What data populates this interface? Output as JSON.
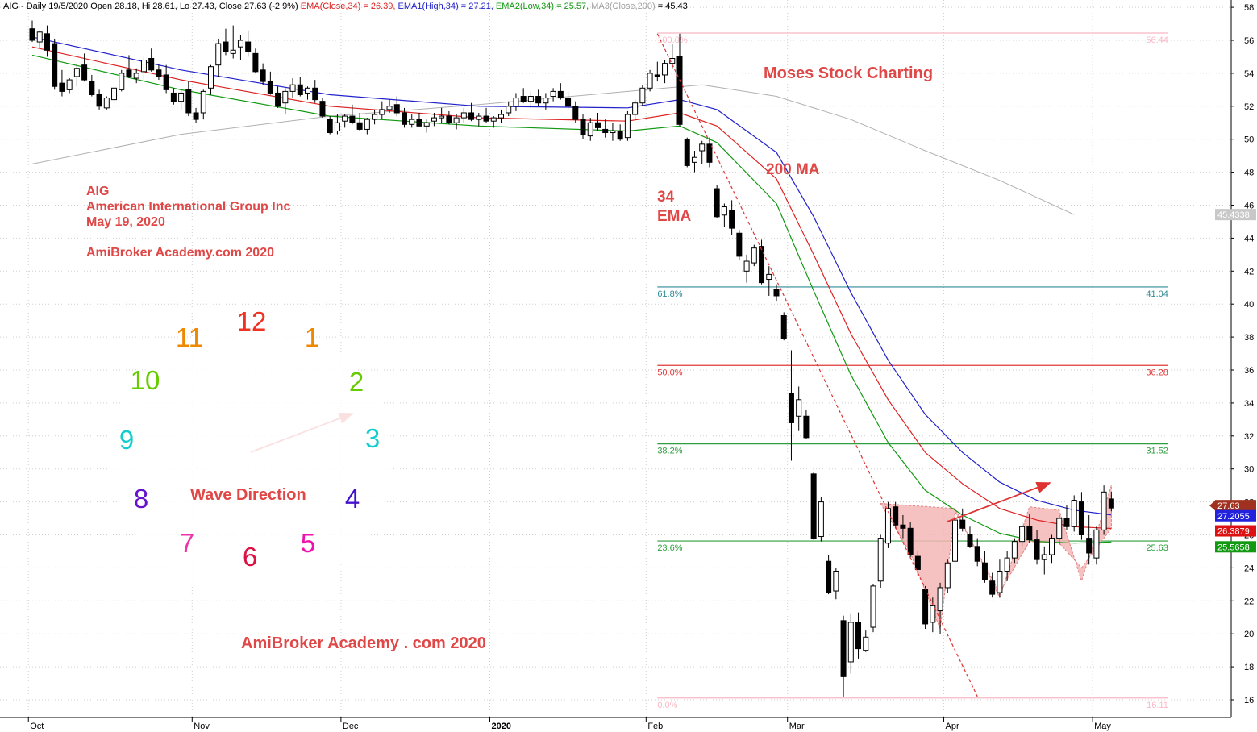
{
  "header": {
    "main": "AIG - Daily 19/5/2020 Open 28.18, Hi 28.61, Lo 27.43, Close 27.63 (-2.9%)",
    "ema": "EMA(Close,34) = 26.39,",
    "ema1": "EMA1(High,34) = 27.21,",
    "ema2": "EMA2(Low,34) = 25.57,",
    "ma3": "MA3(Close,200)",
    "ma3_val": "= 45.43"
  },
  "annotations": {
    "moses": "Moses Stock Charting",
    "ma200": "200 MA",
    "ema34_line1": "34",
    "ema34_line2": "EMA",
    "info": [
      "AIG",
      "American International Group Inc",
      "May 19, 2020",
      "AmiBroker Academy.com  2020"
    ],
    "wave": "Wave Direction",
    "footer": "AmiBroker  Academy . com  2020"
  },
  "clock": {
    "numbers": [
      "12",
      "1",
      "2",
      "3",
      "4",
      "5",
      "6",
      "7",
      "8",
      "9",
      "10",
      "11"
    ],
    "colors": [
      "#ee3322",
      "#ee8800",
      "#66cc00",
      "#11cccc",
      "#4411cc",
      "#ee11aa",
      "#dd1144",
      "#ee33aa",
      "#6611cc",
      "#11cccc",
      "#66cc00",
      "#ee8800"
    ]
  },
  "colors": {
    "ema": "#dd2222",
    "ema_high": "#2222cc",
    "ema_low": "#119911",
    "ma200": "#b0b0b0",
    "bull": "#ffffff",
    "bear": "#000000",
    "pattern_fill": "#f4b6b6",
    "pattern_stroke": "#e08080",
    "trend": "#dd3333",
    "fib_0": "#f9b8c4",
    "fib_23": "#2e9e3e",
    "fib_38": "#2e9e3e",
    "fib_50": "#e03838",
    "fib_61": "#2f8a96",
    "fib_100": "#f9b8c4"
  },
  "chart_data": {
    "type": "candlestick",
    "title": "AIG - Daily",
    "ylim": [
      15.5,
      58.5
    ],
    "y_ticks": [
      16,
      18,
      20,
      22,
      24,
      26,
      28,
      30,
      32,
      34,
      36,
      38,
      40,
      42,
      44,
      46,
      48,
      50,
      52,
      54,
      56,
      58
    ],
    "x_months": [
      {
        "label": "Oct",
        "bar": 1
      },
      {
        "label": "Nov",
        "bar": 23
      },
      {
        "label": "Dec",
        "bar": 43
      },
      {
        "label": "2020",
        "bar": 63
      },
      {
        "label": "Feb",
        "bar": 84
      },
      {
        "label": "Mar",
        "bar": 103
      },
      {
        "label": "Apr",
        "bar": 124
      },
      {
        "label": "May",
        "bar": 144
      }
    ],
    "grid": true,
    "candles": [
      [
        0,
        56.7,
        57.2,
        55.9,
        56.0
      ],
      [
        1,
        55.9,
        56.6,
        55.5,
        56.5
      ],
      [
        2,
        56.4,
        56.9,
        55.0,
        55.4
      ],
      [
        3,
        55.8,
        56.1,
        53.0,
        53.2
      ],
      [
        4,
        53.4,
        54.2,
        52.6,
        52.9
      ],
      [
        5,
        53.0,
        53.7,
        52.8,
        53.6
      ],
      [
        6,
        53.8,
        54.6,
        53.2,
        54.3
      ],
      [
        7,
        54.5,
        55.2,
        53.5,
        53.6
      ],
      [
        8,
        53.5,
        53.9,
        52.6,
        52.7
      ],
      [
        9,
        52.7,
        53.0,
        51.8,
        52.0
      ],
      [
        10,
        51.9,
        52.6,
        51.8,
        52.5
      ],
      [
        11,
        52.4,
        53.2,
        52.1,
        53.1
      ],
      [
        12,
        53.0,
        54.2,
        52.9,
        54.0
      ],
      [
        13,
        54.2,
        55.1,
        53.7,
        53.8
      ],
      [
        14,
        53.7,
        54.3,
        53.4,
        54.0
      ],
      [
        15,
        54.1,
        55.0,
        53.6,
        54.8
      ],
      [
        16,
        54.9,
        55.5,
        54.1,
        54.2
      ],
      [
        17,
        54.2,
        54.5,
        53.6,
        53.8
      ],
      [
        18,
        53.9,
        54.5,
        52.8,
        53.0
      ],
      [
        19,
        52.8,
        53.1,
        52.1,
        52.3
      ],
      [
        20,
        52.3,
        53.0,
        51.8,
        52.8
      ],
      [
        21,
        53.0,
        53.5,
        51.4,
        51.6
      ],
      [
        22,
        51.6,
        51.9,
        51.0,
        51.2
      ],
      [
        23,
        51.6,
        53.0,
        51.2,
        52.9
      ],
      [
        24,
        53.1,
        54.5,
        52.7,
        54.4
      ],
      [
        25,
        54.5,
        56.1,
        53.8,
        55.8
      ],
      [
        26,
        55.9,
        56.7,
        55.1,
        55.3
      ],
      [
        27,
        55.2,
        56.9,
        54.9,
        55.4
      ],
      [
        28,
        55.6,
        56.3,
        54.8,
        56.0
      ],
      [
        29,
        55.9,
        56.6,
        55.0,
        55.3
      ],
      [
        30,
        55.2,
        55.5,
        54.0,
        54.1
      ],
      [
        31,
        54.2,
        54.6,
        53.3,
        53.5
      ],
      [
        32,
        53.5,
        54.1,
        52.7,
        52.8
      ],
      [
        33,
        52.8,
        53.2,
        51.9,
        52.0
      ],
      [
        34,
        52.2,
        53.1,
        51.5,
        52.9
      ],
      [
        35,
        52.9,
        53.7,
        52.5,
        53.3
      ],
      [
        36,
        53.3,
        53.8,
        52.6,
        52.7
      ],
      [
        37,
        52.8,
        53.2,
        52.4,
        53.1
      ],
      [
        38,
        53.1,
        53.6,
        52.2,
        52.4
      ],
      [
        39,
        52.3,
        52.5,
        51.3,
        51.4
      ],
      [
        40,
        51.2,
        51.4,
        50.3,
        50.4
      ],
      [
        41,
        50.5,
        51.5,
        50.3,
        51.0
      ],
      [
        42,
        51.1,
        51.5,
        50.7,
        51.4
      ],
      [
        43,
        51.4,
        52.1,
        50.9,
        51.0
      ],
      [
        44,
        51.0,
        51.6,
        50.5,
        50.6
      ],
      [
        45,
        50.6,
        51.3,
        50.3,
        51.2
      ],
      [
        46,
        51.2,
        51.8,
        50.9,
        51.5
      ],
      [
        47,
        51.5,
        52.3,
        51.2,
        51.8
      ],
      [
        48,
        51.8,
        52.4,
        51.6,
        52.0
      ],
      [
        49,
        52.1,
        52.6,
        51.4,
        51.6
      ],
      [
        50,
        51.6,
        51.9,
        50.7,
        50.9
      ],
      [
        51,
        50.9,
        51.5,
        50.7,
        51.2
      ],
      [
        52,
        51.2,
        51.6,
        50.8,
        50.8
      ],
      [
        53,
        50.8,
        51.2,
        50.4,
        51.0
      ],
      [
        54,
        51.1,
        51.6,
        50.8,
        51.3
      ],
      [
        55,
        51.3,
        51.9,
        51.0,
        51.4
      ],
      [
        56,
        51.4,
        51.7,
        50.9,
        51.0
      ],
      [
        57,
        51.0,
        51.5,
        50.6,
        51.3
      ],
      [
        58,
        51.3,
        51.9,
        51.0,
        51.6
      ],
      [
        59,
        51.6,
        52.2,
        51.1,
        51.2
      ],
      [
        60,
        51.2,
        51.6,
        50.8,
        51.4
      ],
      [
        61,
        51.4,
        51.9,
        51.0,
        51.1
      ],
      [
        62,
        51.1,
        51.4,
        50.7,
        51.3
      ],
      [
        63,
        51.3,
        51.8,
        51.0,
        51.5
      ],
      [
        64,
        51.6,
        52.3,
        51.4,
        52.0
      ],
      [
        65,
        52.0,
        52.8,
        51.7,
        52.5
      ],
      [
        66,
        52.6,
        53.1,
        52.2,
        52.3
      ],
      [
        67,
        52.3,
        52.9,
        51.9,
        52.6
      ],
      [
        68,
        52.6,
        53.0,
        52.0,
        52.2
      ],
      [
        69,
        52.2,
        52.8,
        51.8,
        52.5
      ],
      [
        70,
        52.6,
        53.1,
        52.3,
        52.9
      ],
      [
        71,
        52.9,
        53.4,
        52.4,
        52.5
      ],
      [
        72,
        52.5,
        52.9,
        51.8,
        52.0
      ],
      [
        73,
        52.0,
        52.3,
        51.0,
        51.2
      ],
      [
        74,
        51.2,
        51.5,
        50.0,
        50.3
      ],
      [
        75,
        50.2,
        51.3,
        49.9,
        51.0
      ],
      [
        76,
        51.0,
        51.6,
        50.5,
        50.7
      ],
      [
        77,
        50.6,
        51.2,
        50.1,
        50.4
      ],
      [
        78,
        50.4,
        51.0,
        49.9,
        50.5
      ],
      [
        79,
        50.5,
        50.9,
        49.9,
        50.0
      ],
      [
        80,
        50.1,
        51.7,
        49.9,
        51.5
      ],
      [
        81,
        51.5,
        52.4,
        51.2,
        52.2
      ],
      [
        82,
        52.2,
        53.3,
        52.0,
        53.1
      ],
      [
        83,
        53.1,
        54.2,
        52.9,
        54.0
      ],
      [
        84,
        53.9,
        54.7,
        53.5,
        53.8
      ],
      [
        85,
        53.9,
        54.8,
        53.4,
        54.6
      ],
      [
        86,
        54.6,
        55.8,
        54.3,
        54.9
      ],
      [
        87,
        55.0,
        56.4,
        50.8,
        50.9
      ],
      [
        88,
        50.0,
        50.1,
        48.3,
        48.4
      ],
      [
        89,
        48.6,
        49.3,
        48.0,
        48.9
      ],
      [
        90,
        49.3,
        49.9,
        48.5,
        49.7
      ],
      [
        91,
        49.7,
        50.1,
        48.3,
        48.6
      ],
      [
        92,
        47.0,
        47.2,
        45.2,
        45.3
      ],
      [
        93,
        45.4,
        46.1,
        44.7,
        45.9
      ],
      [
        94,
        45.7,
        46.3,
        44.2,
        44.6
      ],
      [
        95,
        44.3,
        44.5,
        42.7,
        42.9
      ],
      [
        96,
        42.0,
        43.0,
        41.3,
        42.6
      ],
      [
        97,
        42.5,
        43.6,
        42.3,
        43.4
      ],
      [
        98,
        43.5,
        43.9,
        41.2,
        41.3
      ],
      [
        99,
        41.5,
        42.3,
        40.5,
        41.8
      ],
      [
        100,
        40.9,
        41.2,
        40.2,
        40.5
      ],
      [
        101,
        39.3,
        39.5,
        37.8,
        37.9
      ],
      [
        102,
        34.6,
        37.2,
        30.5,
        32.8
      ],
      [
        103,
        33.2,
        35.0,
        32.3,
        34.2
      ],
      [
        104,
        33.2,
        33.6,
        31.8,
        31.9
      ],
      [
        105,
        29.7,
        29.8,
        25.7,
        25.8
      ],
      [
        106,
        25.9,
        28.3,
        25.6,
        28.0
      ],
      [
        107,
        24.4,
        24.8,
        22.4,
        22.5
      ],
      [
        108,
        22.6,
        24.0,
        22.1,
        23.8
      ],
      [
        109,
        20.8,
        21.1,
        16.2,
        17.4
      ],
      [
        110,
        18.3,
        21.2,
        17.6,
        20.7
      ],
      [
        111,
        20.7,
        21.3,
        18.5,
        19.1
      ],
      [
        112,
        19.0,
        20.2,
        18.9,
        19.8
      ],
      [
        113,
        20.4,
        23.0,
        20.1,
        22.9
      ],
      [
        114,
        23.2,
        26.0,
        22.8,
        25.8
      ],
      [
        115,
        25.5,
        28.0,
        25.2,
        27.6
      ],
      [
        116,
        27.7,
        28.0,
        26.4,
        26.6
      ],
      [
        117,
        26.6,
        27.2,
        25.8,
        26.4
      ],
      [
        118,
        26.4,
        26.8,
        24.6,
        24.8
      ],
      [
        119,
        24.7,
        25.0,
        23.5,
        23.9
      ],
      [
        120,
        22.7,
        22.9,
        20.3,
        20.6
      ],
      [
        121,
        20.7,
        22.2,
        20.1,
        21.7
      ],
      [
        122,
        21.4,
        23.1,
        20.0,
        22.8
      ],
      [
        123,
        22.8,
        24.5,
        22.5,
        24.3
      ],
      [
        124,
        24.4,
        27.0,
        24.0,
        26.9
      ],
      [
        125,
        26.9,
        27.6,
        26.2,
        26.4
      ],
      [
        126,
        26.0,
        26.5,
        25.2,
        25.3
      ],
      [
        127,
        25.3,
        25.8,
        24.1,
        24.4
      ],
      [
        128,
        24.3,
        25.0,
        23.1,
        23.3
      ],
      [
        129,
        23.2,
        23.7,
        22.2,
        22.4
      ],
      [
        130,
        22.5,
        24.5,
        22.2,
        23.8
      ],
      [
        131,
        23.8,
        25.0,
        23.2,
        24.6
      ],
      [
        132,
        24.6,
        25.8,
        24.3,
        25.6
      ],
      [
        133,
        25.6,
        26.8,
        25.3,
        26.5
      ],
      [
        134,
        26.5,
        27.3,
        25.5,
        25.7
      ],
      [
        135,
        25.7,
        26.3,
        24.2,
        24.5
      ],
      [
        136,
        24.5,
        25.3,
        23.6,
        24.8
      ],
      [
        137,
        24.8,
        26.0,
        24.3,
        25.8
      ],
      [
        138,
        25.8,
        27.2,
        25.4,
        27.0
      ],
      [
        139,
        27.0,
        27.8,
        26.3,
        26.5
      ],
      [
        140,
        26.5,
        28.4,
        26.2,
        28.1
      ],
      [
        141,
        28.0,
        28.6,
        25.7,
        26.0
      ],
      [
        142,
        25.8,
        27.2,
        24.2,
        24.9
      ],
      [
        143,
        24.6,
        26.5,
        24.2,
        26.3
      ],
      [
        144,
        26.3,
        29.0,
        26.0,
        28.6
      ],
      [
        145,
        28.18,
        28.61,
        27.43,
        27.63
      ]
    ],
    "ema_close_34": [
      [
        0,
        55.6
      ],
      [
        20,
        53.6
      ],
      [
        40,
        52.0
      ],
      [
        60,
        51.3
      ],
      [
        80,
        51.1
      ],
      [
        87,
        51.6
      ],
      [
        92,
        50.8
      ],
      [
        100,
        47.6
      ],
      [
        105,
        43.0
      ],
      [
        110,
        38.2
      ],
      [
        115,
        34.2
      ],
      [
        120,
        31.0
      ],
      [
        125,
        29.1
      ],
      [
        130,
        27.6
      ],
      [
        135,
        26.9
      ],
      [
        140,
        26.5
      ],
      [
        145,
        26.39
      ]
    ],
    "ema_high_34": [
      [
        0,
        56.2
      ],
      [
        20,
        54.2
      ],
      [
        40,
        52.7
      ],
      [
        60,
        52.0
      ],
      [
        80,
        51.9
      ],
      [
        87,
        52.4
      ],
      [
        92,
        51.8
      ],
      [
        100,
        49.2
      ],
      [
        105,
        45.3
      ],
      [
        110,
        40.7
      ],
      [
        115,
        36.6
      ],
      [
        120,
        33.3
      ],
      [
        125,
        31.0
      ],
      [
        130,
        29.2
      ],
      [
        135,
        28.1
      ],
      [
        140,
        27.5
      ],
      [
        145,
        27.21
      ]
    ],
    "ema_low_34": [
      [
        0,
        55.1
      ],
      [
        20,
        53.0
      ],
      [
        40,
        51.4
      ],
      [
        60,
        50.8
      ],
      [
        80,
        50.5
      ],
      [
        87,
        50.8
      ],
      [
        92,
        49.8
      ],
      [
        100,
        46.1
      ],
      [
        105,
        40.8
      ],
      [
        110,
        35.7
      ],
      [
        115,
        31.6
      ],
      [
        120,
        28.7
      ],
      [
        125,
        27.2
      ],
      [
        130,
        26.1
      ],
      [
        135,
        25.6
      ],
      [
        140,
        25.5
      ],
      [
        145,
        25.57
      ]
    ],
    "ma_close_200": [
      [
        0,
        48.5
      ],
      [
        20,
        50.3
      ],
      [
        40,
        51.4
      ],
      [
        60,
        52.1
      ],
      [
        80,
        52.9
      ],
      [
        90,
        53.3
      ],
      [
        100,
        52.6
      ],
      [
        110,
        51.2
      ],
      [
        120,
        49.3
      ],
      [
        130,
        47.5
      ],
      [
        140,
        45.43
      ]
    ],
    "fibonacci": {
      "start_bar": 84,
      "end_bar": 156,
      "levels": [
        {
          "left": "100.0%",
          "right": "56.44",
          "value": 56.44,
          "key": "fib_100"
        },
        {
          "left": "61.8%",
          "right": "41.04",
          "value": 41.04,
          "key": "fib_61"
        },
        {
          "left": "50.0%",
          "right": "36.28",
          "value": 36.28,
          "key": "fib_50"
        },
        {
          "left": "38.2%",
          "right": "31.52",
          "value": 31.52,
          "key": "fib_38"
        },
        {
          "left": "23.6%",
          "right": "25.63",
          "value": 25.63,
          "key": "fib_23"
        },
        {
          "left": "0.0%",
          "right": "16.11",
          "value": 16.11,
          "key": "fib_0"
        }
      ]
    },
    "price_labels": [
      {
        "text": "45.4338",
        "value": 45.43,
        "bg": "#c8c8c8",
        "fg": "#000000"
      },
      {
        "text": "27.63",
        "value": 27.63,
        "bg": "#a0311f",
        "fg": "#ffffff",
        "arrow": true
      },
      {
        "text": "27.2055",
        "value": 27.21,
        "bg": "#2222dd",
        "fg": "#ffffff"
      },
      {
        "text": "26.3879",
        "value": 26.39,
        "bg": "#dd1111",
        "fg": "#ffffff"
      },
      {
        "text": "25.5658",
        "value": 25.57,
        "bg": "#119911",
        "fg": "#ffffff"
      }
    ],
    "pattern": [
      [
        114,
        27.9
      ],
      [
        124,
        27.6
      ],
      [
        130,
        22.2
      ],
      [
        134,
        27.7
      ],
      [
        138,
        27.5
      ],
      [
        141,
        23.2
      ],
      [
        145,
        29.0
      ],
      [
        145,
        26.4
      ],
      [
        141,
        24.0
      ],
      [
        138,
        25.5
      ],
      [
        134,
        25.6
      ],
      [
        130,
        22.5
      ],
      [
        124,
        27.4
      ],
      [
        122,
        20.3
      ],
      [
        118,
        24.9
      ],
      [
        114,
        27.9
      ]
    ],
    "trend_dotted": [
      [
        84,
        56.4
      ],
      [
        127,
        16.2
      ]
    ]
  }
}
